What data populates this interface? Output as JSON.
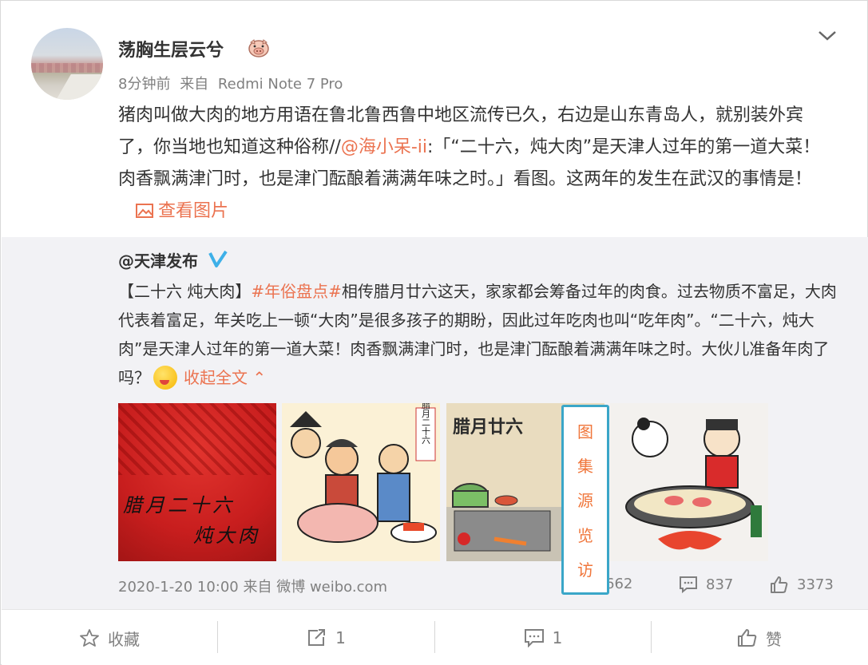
{
  "post": {
    "author": "荡胸生层云兮",
    "time": "8分钟前",
    "source_prefix": "来自",
    "source": "Redmi Note 7 Pro",
    "text_part1": "猪肉叫做大肉的地方用语在鲁北鲁西鲁中地区流传已久，右边是山东青岛人，就别装外宾了，你当地也知道这种俗称//",
    "mention": "@海小呆-ii",
    "text_part2": ":「“二十六，炖大肉”是天津人过年的第一道大菜！肉香飘满津门时，也是津门酝酿着满满年味之时。」看图。这两年的发生在武汉的事情是！",
    "view_pic_label": "查看图片"
  },
  "repost": {
    "author": "@天津发布",
    "text_prefix": "【二十六 炖大肉】",
    "hashtag": "#年俗盘点#",
    "text_body": "相传腊月廿六这天，家家都会筹备过年的肉食。过去物质不富足，大肉代表着富足，年关吃上一顿“大肉”是很多孩子的期盼，因此过年吃肉也叫“吃年肉”。“二十六，炖大肉”是天津人过年的第一道大菜！肉香飘满津门时，也是津门酝酿着满满年味之时。大伙儿准备年肉了吗？",
    "collapse_label": "收起全文 ⌃",
    "images": [
      {
        "text1": "腊月二十六",
        "text2": "炖大肉"
      },
      {
        "text": "腊月二十六"
      },
      {
        "text": "腊月廿六"
      },
      {
        "text": ""
      }
    ],
    "date": "2020-1-20 10:00",
    "source_prefix": "来自",
    "source": "微博 weibo.com",
    "reposts": "662",
    "comments": "837",
    "likes": "3373"
  },
  "widget": {
    "chars": [
      "图",
      "集",
      "源",
      "览",
      "访"
    ]
  },
  "actions": {
    "favorite": "收藏",
    "repost": "1",
    "comment": "1",
    "like": "赞"
  },
  "colors": {
    "accent": "#eb7350",
    "repost_bg": "#f2f2f5",
    "widget_border": "#3aa6c8",
    "widget_text": "#f0763b"
  },
  "icons": {
    "expand": "chevron-down-icon",
    "badge": "pig-badge-icon",
    "verified": "verified-v-icon",
    "picture": "picture-icon",
    "repost": "repost-icon",
    "comment": "comment-icon",
    "like": "thumbs-up-icon",
    "favorite": "star-icon"
  }
}
